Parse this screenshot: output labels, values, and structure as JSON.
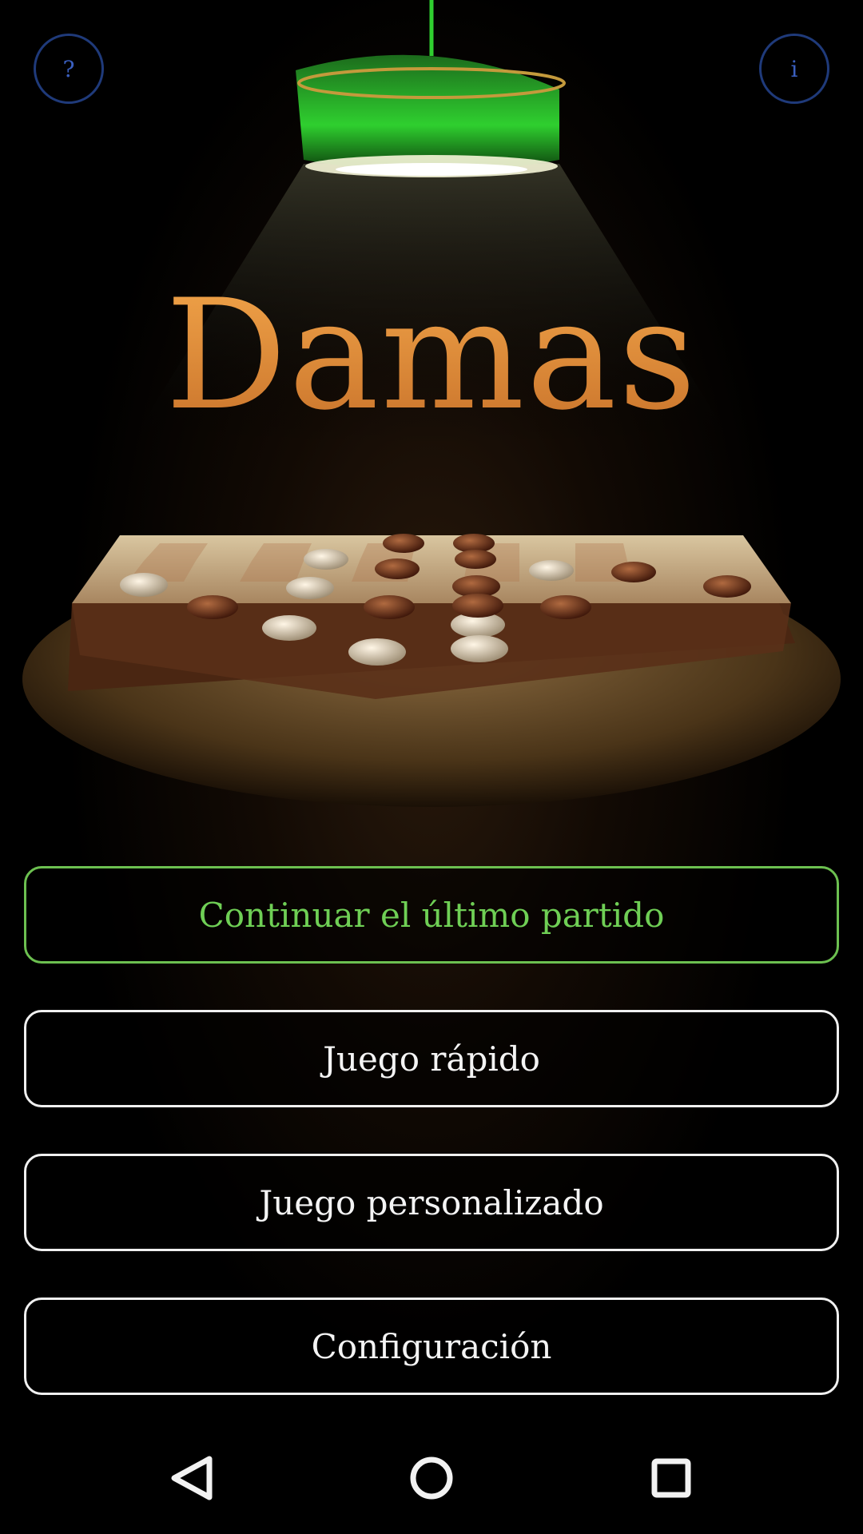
{
  "top_buttons": {
    "help_label": "?",
    "info_label": "i"
  },
  "title": "Damas",
  "menu": {
    "continue_label": "Continuar el último partido",
    "quick_game_label": "Juego rápido",
    "custom_game_label": "Juego personalizado",
    "settings_label": "Configuración"
  },
  "icons": {
    "help": "question-icon",
    "info": "info-icon",
    "lamp": "lamp-icon",
    "nav_back": "back-triangle-icon",
    "nav_home": "home-circle-icon",
    "nav_recents": "recents-square-icon"
  },
  "colors": {
    "accent_green": "#6cc050",
    "title_orange": "#e89a40",
    "top_button_blue": "#1f3a7a",
    "button_border": "#f0f0f0"
  }
}
